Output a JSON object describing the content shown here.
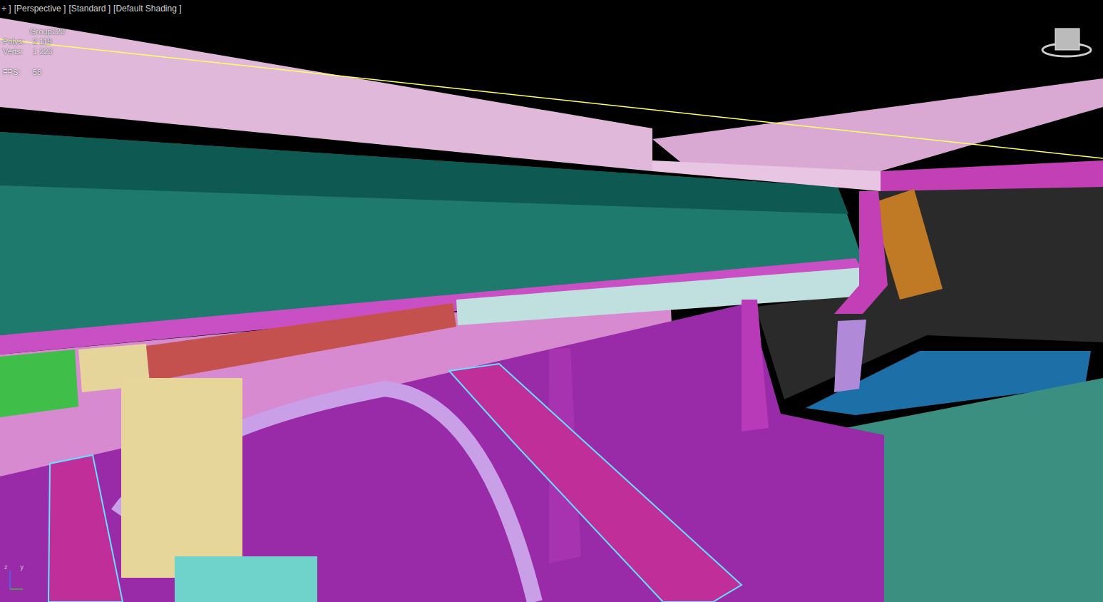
{
  "viewport": {
    "labels": [
      "+ ]",
      "[Perspective ]",
      "[Standard ]",
      "[Default Shading ]"
    ]
  },
  "stats": [
    {
      "label": "",
      "value": "Group120"
    },
    {
      "label": "Polys:",
      "value": "2 119"
    },
    {
      "label": "Verts:",
      "value": "1 223"
    },
    {
      "label": "FPS:",
      "value": "58"
    }
  ],
  "gizmo": {
    "axes": [
      "z",
      "y"
    ]
  }
}
